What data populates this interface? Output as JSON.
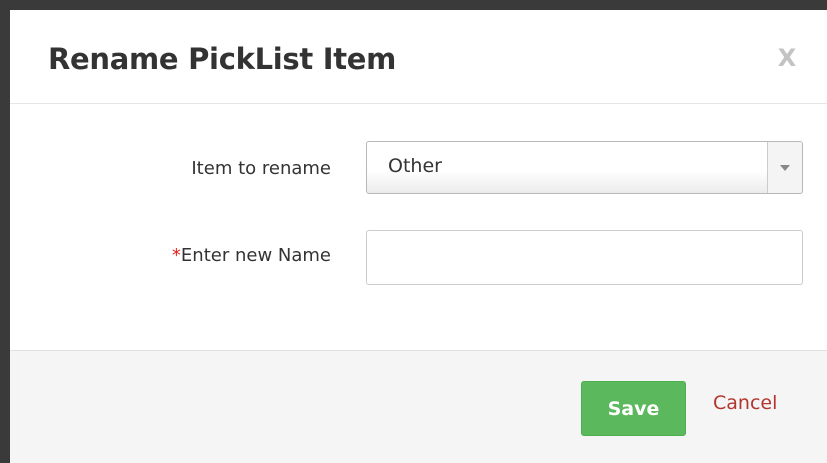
{
  "dialog": {
    "title": "Rename PickList Item",
    "close_label": "X"
  },
  "form": {
    "item_to_rename": {
      "label": "Item to rename",
      "selected_value": "Other"
    },
    "new_name": {
      "required_marker": "*",
      "label": "Enter new Name",
      "value": "",
      "placeholder": ""
    }
  },
  "footer": {
    "save_label": "Save",
    "cancel_label": "Cancel"
  },
  "colors": {
    "save_button": "#5cb85c",
    "cancel_link": "#b3362e",
    "required_star": "#e0201b"
  },
  "icons": {
    "dropdown": "chevron-down-icon",
    "close": "close-icon"
  }
}
